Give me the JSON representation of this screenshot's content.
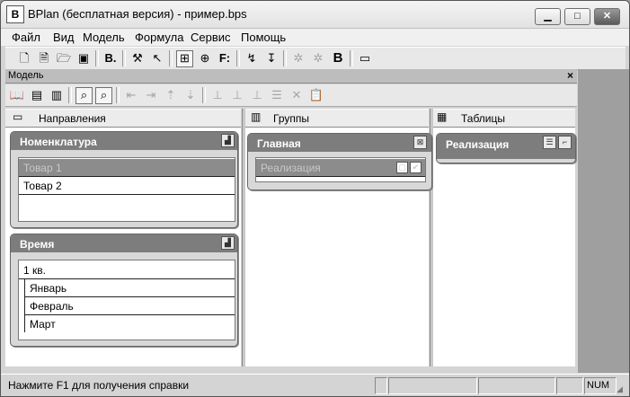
{
  "window": {
    "title": "BPlan (бесплатная версия) - пример.bps",
    "app_icon": "B"
  },
  "window_buttons": {
    "minimize": "▁",
    "maximize": "□",
    "close": "✕"
  },
  "menu": [
    "Файл",
    "Вид",
    "Модель",
    "Формула",
    "Сервис",
    "Помощь"
  ],
  "toolbar_text": {
    "bold_b": "B.",
    "f": "F:",
    "big_b": "B"
  },
  "model_panel": {
    "title": "Модель",
    "close": "×"
  },
  "columns": {
    "directions": {
      "label": "Направления"
    },
    "groups": {
      "label": "Группы"
    },
    "tables": {
      "label": "Таблицы"
    }
  },
  "cards": {
    "nomenclature": {
      "title": "Номенклатура",
      "items": [
        "Товар 1",
        "Товар 2"
      ],
      "selected_index": 0
    },
    "time": {
      "title": "Время",
      "root": "1 кв.",
      "children": [
        "Январь",
        "Февраль",
        "Март"
      ]
    },
    "main_group": {
      "title": "Главная",
      "items": [
        "Реализация"
      ]
    },
    "sales_table": {
      "title": "Реализация"
    }
  },
  "status": {
    "help": "Нажмите F1 для получения справки",
    "num": "NUM"
  },
  "icons": {
    "toolbar1": [
      "new-doc-icon",
      "new-doc-list-icon",
      "open-folder-icon",
      "save-icon",
      "bold-b-icon",
      "tools-icon",
      "help-pointer-icon",
      "tree-icon",
      "tree-add-icon",
      "formula-icon",
      "calc-up-icon",
      "calc-down-icon",
      "group-icon",
      "ungroup-icon",
      "report-b-icon",
      "monitor-icon"
    ],
    "toolbar2": [
      "book-icon",
      "table-edit-icon",
      "table-abc-icon",
      "zoom-icon",
      "zoom-fit-icon",
      "move-left-icon",
      "move-right-icon",
      "move-up-icon",
      "move-down-icon",
      "insert-icon",
      "insert-abc-icon",
      "insert-abc2-icon",
      "list-icon",
      "delete-icon",
      "paste-icon"
    ]
  }
}
